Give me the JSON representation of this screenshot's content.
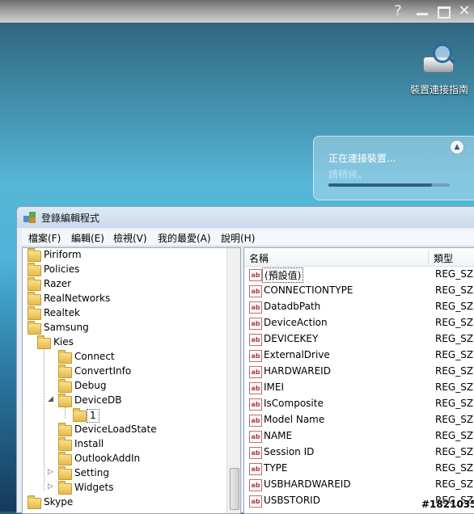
{
  "background_app": {
    "controls": {
      "help": "?",
      "close": "✕"
    },
    "guide_label": "裝置連接指南",
    "notification": {
      "status": "正在連接裝置...",
      "wait": "請稍候。",
      "progress": 0.85
    }
  },
  "regedit": {
    "title": "登錄編輯程式",
    "menu": [
      "檔案(F)",
      "編輯(E)",
      "檢視(V)",
      "我的最愛(A)",
      "說明(H)"
    ],
    "tree": [
      {
        "label": "Piriform",
        "level": 0
      },
      {
        "label": "Policies",
        "level": 0
      },
      {
        "label": "Razer",
        "level": 0
      },
      {
        "label": "RealNetworks",
        "level": 0
      },
      {
        "label": "Realtek",
        "level": 0
      },
      {
        "label": "Samsung",
        "level": 0
      },
      {
        "label": "Kies",
        "level": 1
      },
      {
        "label": "Connect",
        "level": 2
      },
      {
        "label": "ConvertInfo",
        "level": 2
      },
      {
        "label": "Debug",
        "level": 2
      },
      {
        "label": "DeviceDB",
        "level": 2,
        "expanded": true
      },
      {
        "label": "1",
        "level": 3,
        "selected": true
      },
      {
        "label": "DeviceLoadState",
        "level": 2
      },
      {
        "label": "Install",
        "level": 2
      },
      {
        "label": "OutlookAddIn",
        "level": 2
      },
      {
        "label": "Setting",
        "level": 2,
        "collapsed": true
      },
      {
        "label": "Widgets",
        "level": 2,
        "collapsed": true
      },
      {
        "label": "Skype",
        "level": 0
      }
    ],
    "columns": {
      "name": "名稱",
      "type": "類型"
    },
    "values": [
      {
        "name": "(預設值)",
        "type": "REG_SZ"
      },
      {
        "name": "CONNECTIONTYPE",
        "type": "REG_SZ"
      },
      {
        "name": "DatadbPath",
        "type": "REG_SZ"
      },
      {
        "name": "DeviceAction",
        "type": "REG_SZ"
      },
      {
        "name": "DEVICEKEY",
        "type": "REG_SZ"
      },
      {
        "name": "ExternalDrive",
        "type": "REG_SZ"
      },
      {
        "name": "HARDWAREID",
        "type": "REG_SZ"
      },
      {
        "name": "IMEI",
        "type": "REG_SZ"
      },
      {
        "name": "IsComposite",
        "type": "REG_SZ"
      },
      {
        "name": "Model Name",
        "type": "REG_SZ"
      },
      {
        "name": "NAME",
        "type": "REG_SZ"
      },
      {
        "name": "Session ID",
        "type": "REG_SZ"
      },
      {
        "name": "TYPE",
        "type": "REG_SZ"
      },
      {
        "name": "USBHARDWAREID",
        "type": "REG_SZ"
      },
      {
        "name": "USBSTORID",
        "type": "REG_SZ"
      }
    ],
    "value_icon": "ab"
  },
  "watermark": "#1821035"
}
